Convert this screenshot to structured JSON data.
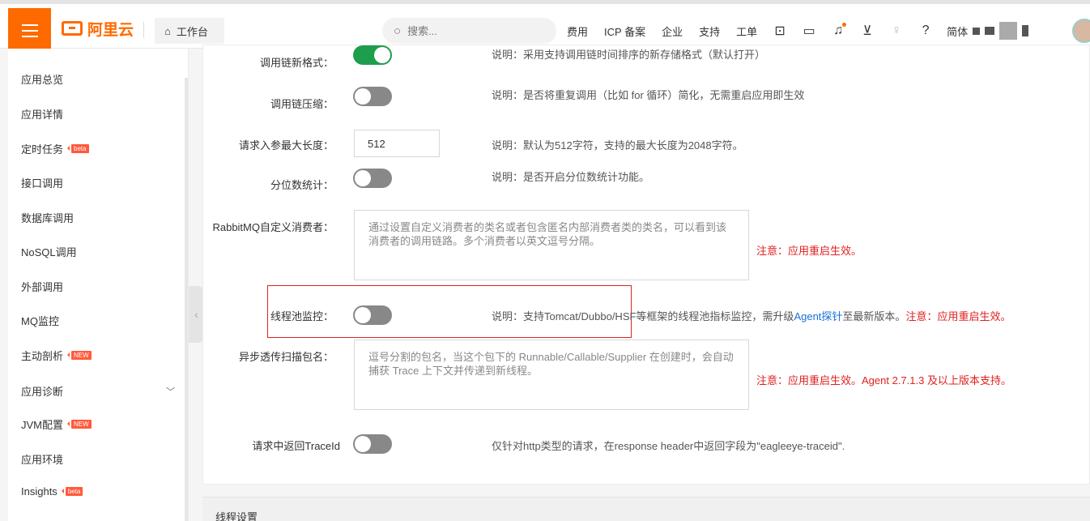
{
  "topbar": {
    "logo_text": "阿里云",
    "workbench_label": "工作台",
    "search_placeholder": "搜索...",
    "nav_links": [
      "费用",
      "ICP 备案",
      "企业",
      "支持",
      "工单"
    ],
    "lang_label": "简体"
  },
  "sidebar": {
    "items": [
      {
        "label": "应用总览"
      },
      {
        "label": "应用详情"
      },
      {
        "label": "定时任务",
        "badge": "beta"
      },
      {
        "label": "接口调用"
      },
      {
        "label": "数据库调用"
      },
      {
        "label": "NoSQL调用"
      },
      {
        "label": "外部调用"
      },
      {
        "label": "MQ监控"
      },
      {
        "label": "主动剖析",
        "badge": "NEW"
      },
      {
        "label": "应用诊断"
      },
      {
        "label": "JVM配置",
        "badge": "NEW"
      },
      {
        "label": "应用环境"
      },
      {
        "label": "Insights",
        "badge": "beta"
      }
    ]
  },
  "settings": {
    "trace_format": {
      "label": "调用链新格式：",
      "enabled": true,
      "desc": "说明：采用支持调用链时间排序的新存储格式（默认打开）"
    },
    "trace_compress": {
      "label": "调用链压缩：",
      "enabled": false,
      "desc": "说明：是否将重复调用（比如 for 循环）简化，无需重启应用即生效"
    },
    "max_param_len": {
      "label": "请求入参最大长度：",
      "value": "512",
      "desc": "说明：默认为512字符，支持的最大长度为2048字符。"
    },
    "quantile": {
      "label": "分位数统计：",
      "enabled": false,
      "desc": "说明：是否开启分位数统计功能。"
    },
    "rabbitmq": {
      "label": "RabbitMQ自定义消费者：",
      "placeholder": "通过设置自定义消费者的类名或者包含匿名内部消费者类的类名，可以看到该消费者的调用链路。多个消费者以英文逗号分隔。",
      "warn": "注意：应用重启生效。"
    },
    "threadpool": {
      "label": "线程池监控：",
      "enabled": false,
      "desc_prefix": "说明：支持Tomcat/Dubbo/HSF等框架的线程池指标监控，需升级",
      "desc_link": "Agent探针",
      "desc_suffix": "至最新版本。",
      "warn": "注意：应用重启生效。"
    },
    "async_scan": {
      "label": "异步透传扫描包名：",
      "placeholder": "逗号分割的包名，当这个包下的 Runnable/Callable/Supplier 在创建时，会自动捕获 Trace 上下文并传递到新线程。",
      "warn": "注意：应用重启生效。Agent 2.7.1.3 及以上版本支持。"
    },
    "return_traceid": {
      "label": "请求中返回TraceId",
      "enabled": false,
      "desc": "仅针对http类型的请求，在response header中返回字段为\"eagleeye-traceid\"."
    }
  },
  "section_thread": {
    "title": "线程设置"
  }
}
